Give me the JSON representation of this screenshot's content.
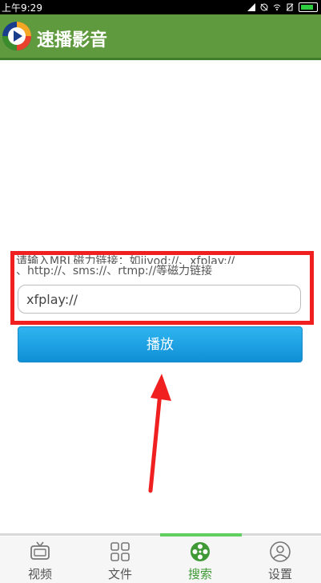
{
  "status_bar": {
    "time": "上午9:29"
  },
  "app": {
    "title": "速播影音"
  },
  "search": {
    "hint_line1": "请输入MRL磁力链接：如jjvod://、xfplay://",
    "hint_line2": "、http://、sms://、rtmp://等磁力链接",
    "value": "xfplay://"
  },
  "play_button": {
    "label": "播放"
  },
  "tabs": [
    {
      "label": "视频",
      "icon": "tv-icon"
    },
    {
      "label": "文件",
      "icon": "grid-icon"
    },
    {
      "label": "搜索",
      "icon": "film-reel-icon",
      "active": true
    },
    {
      "label": "设置",
      "icon": "user-icon"
    }
  ],
  "colors": {
    "appbar": "#5f9b3e",
    "accent_green": "#3f9a35",
    "button_blue": "#1e9fe2",
    "annotation_red": "#f02020"
  }
}
